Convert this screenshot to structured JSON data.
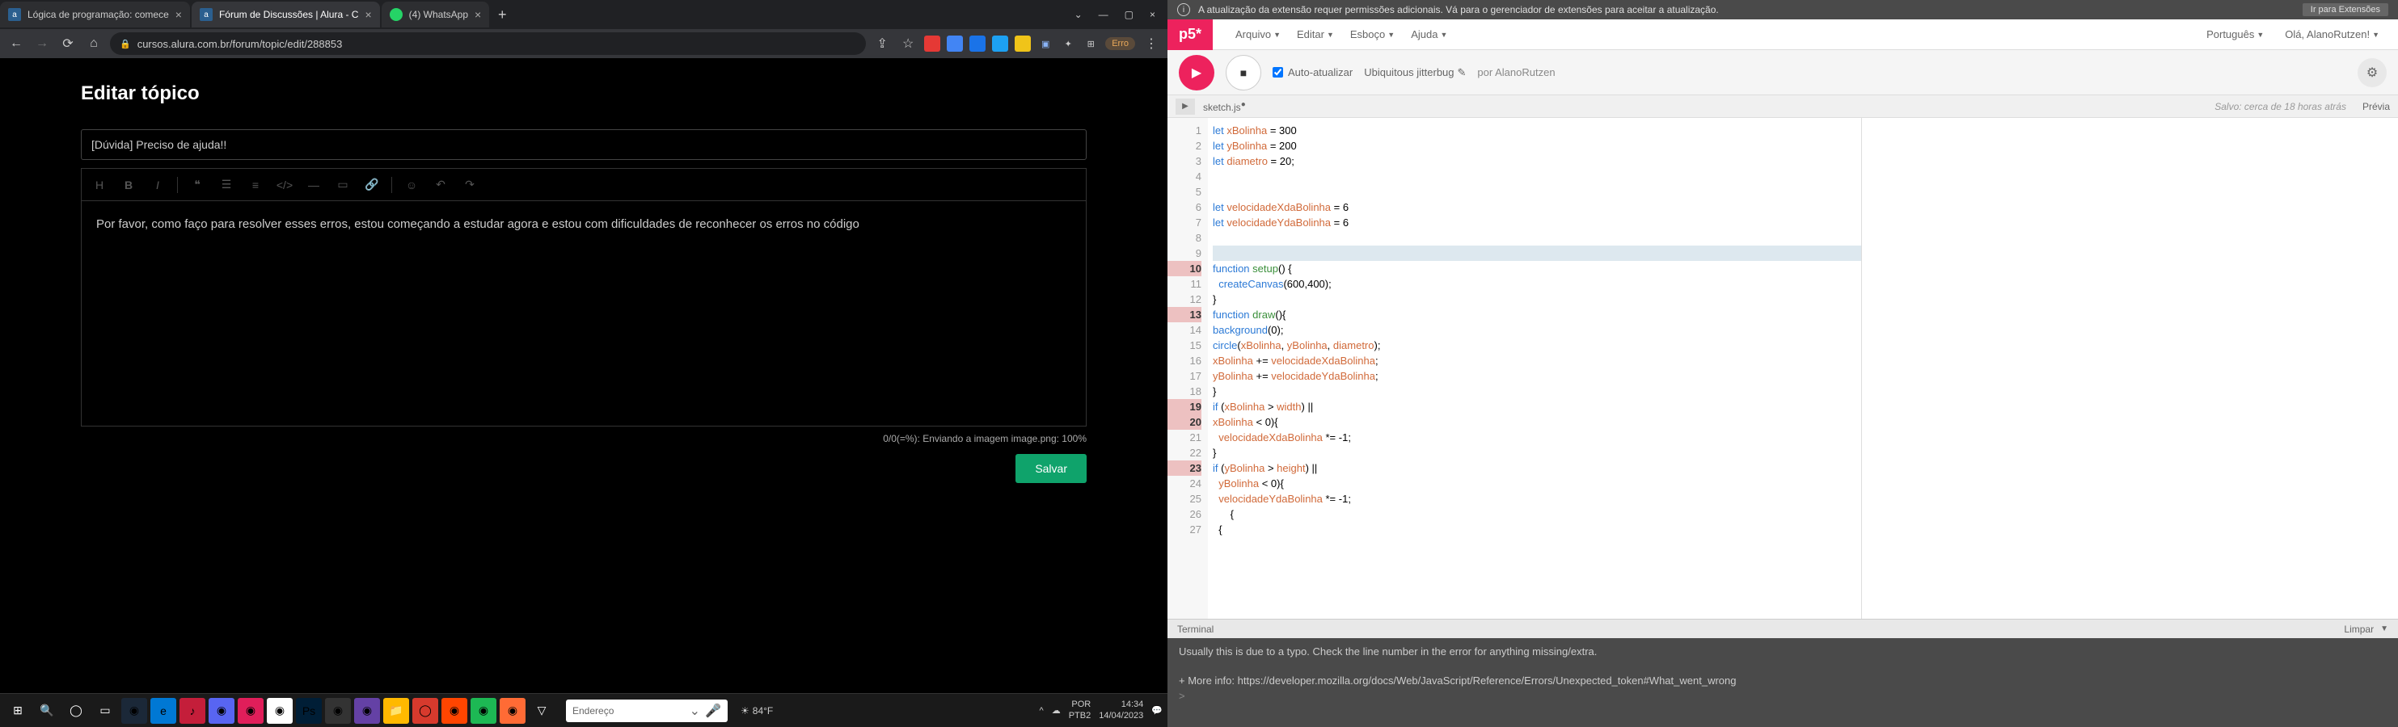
{
  "browser": {
    "tabs": [
      {
        "favicon": "a",
        "title": "Lógica de programação: comece"
      },
      {
        "favicon": "a",
        "title": "Fórum de Discussões | Alura - C",
        "active": true
      },
      {
        "favicon": "wa",
        "title": "(4) WhatsApp"
      }
    ],
    "url": "cursos.alura.com.br/forum/topic/edit/288853",
    "errBadge": "Erro",
    "extColors": [
      "#e53935",
      "#4285f4",
      "#1a73e8",
      "#1da1f2",
      "#f0c419",
      "#5c6bc0",
      "#9e9e9e"
    ]
  },
  "page": {
    "heading": "Editar tópico",
    "titleValue": "[Dúvida] Preciso de ajuda!!",
    "body": "Por favor, como faço para resolver esses erros, estou começando a estudar agora e estou com dificuldades de reconhecer os erros no código",
    "uploadStatus": "0/0(=%): Enviando a imagem image.png: 100%",
    "saveLabel": "Salvar"
  },
  "taskbar": {
    "searchPlaceholder": "Endereço",
    "weather": "84°F",
    "lang1": "POR",
    "lang2": "PTB2",
    "time": "14:34",
    "date": "14/04/2023"
  },
  "notice": {
    "text": "A atualização da extensão requer permissões adicionais. Vá para o gerenciador de extensões para aceitar a atualização.",
    "button": "Ir para Extensões"
  },
  "p5menu": {
    "items": [
      "Arquivo",
      "Editar",
      "Esboço",
      "Ajuda"
    ],
    "lang": "Português",
    "greeting": "Olá, AlanoRutzen!"
  },
  "p5toolbar": {
    "auto": "Auto-atualizar",
    "sketch": "Ubiquitous jitterbug",
    "by": "por AlanoRutzen"
  },
  "filebar": {
    "name": "sketch.js",
    "saved": "Salvo: cerca de 18 horas atrás",
    "preview": "Prévia"
  },
  "code": {
    "lines": [
      {
        "n": 1,
        "html": "<span class='kw'>let</span> <span class='var'>xBolinha</span> = 300"
      },
      {
        "n": 2,
        "html": "<span class='kw'>let</span> <span class='var'>yBolinha</span> = 200"
      },
      {
        "n": 3,
        "html": "<span class='kw'>let</span> <span class='var'>diametro</span> = 20;"
      },
      {
        "n": 4,
        "html": ""
      },
      {
        "n": 5,
        "html": ""
      },
      {
        "n": 6,
        "html": "<span class='kw'>let</span> <span class='var'>velocidadeXdaBolinha</span> = 6"
      },
      {
        "n": 7,
        "html": "<span class='kw'>let</span> <span class='var'>velocidadeYdaBolinha</span> = 6"
      },
      {
        "n": 8,
        "html": ""
      },
      {
        "n": 9,
        "html": "",
        "hl": true
      },
      {
        "n": 10,
        "html": "<span class='kw'>function</span> <span class='fname'>setup</span>() {",
        "err": true
      },
      {
        "n": 11,
        "html": "  <span class='fn'>createCanvas</span>(600,400);"
      },
      {
        "n": 12,
        "html": "}"
      },
      {
        "n": 13,
        "html": "<span class='kw'>function</span> <span class='fname'>draw</span>(){",
        "err": true
      },
      {
        "n": 14,
        "html": "<span class='fn'>background</span>(0);"
      },
      {
        "n": 15,
        "html": "<span class='fn'>circle</span>(<span class='var'>xBolinha</span>, <span class='var'>yBolinha</span>, <span class='var'>diametro</span>);"
      },
      {
        "n": 16,
        "html": "<span class='var'>xBolinha</span> += <span class='var'>velocidadeXdaBolinha</span>;"
      },
      {
        "n": 17,
        "html": "<span class='var'>yBolinha</span> += <span class='var'>velocidadeYdaBolinha</span>;"
      },
      {
        "n": 18,
        "html": "}"
      },
      {
        "n": 19,
        "html": "<span class='kw'>if</span> (<span class='var'>xBolinha</span> > <span class='var'>width</span>) <u>||</u>",
        "err": true
      },
      {
        "n": 20,
        "html": "<span class='var'>xBolinha</span> < 0){",
        "err": true
      },
      {
        "n": 21,
        "html": "  <span class='var'>velocidadeXdaBolinha</span> *= -1;"
      },
      {
        "n": 22,
        "html": "}"
      },
      {
        "n": 23,
        "html": "<span class='kw'>if</span> (<span class='var'>yBolinha</span> > <span class='var'>height</span>) <u>||</u>",
        "err": true
      },
      {
        "n": 24,
        "html": "  <span class='var'>yBolinha</span> < 0){"
      },
      {
        "n": 25,
        "html": "  <span class='var'>velocidadeYdaBolinha</span> *= -1;"
      },
      {
        "n": 26,
        "html": "      {"
      },
      {
        "n": 27,
        "html": "  {"
      }
    ]
  },
  "terminal": {
    "header": "Terminal",
    "clear": "Limpar",
    "line1": "Usually this is due to a typo. Check the line number in the error for anything missing/extra.",
    "line2": "+ More info: https://developer.mozilla.org/docs/Web/JavaScript/Reference/Errors/Unexpected_token#What_went_wrong",
    "prompt": ">"
  }
}
